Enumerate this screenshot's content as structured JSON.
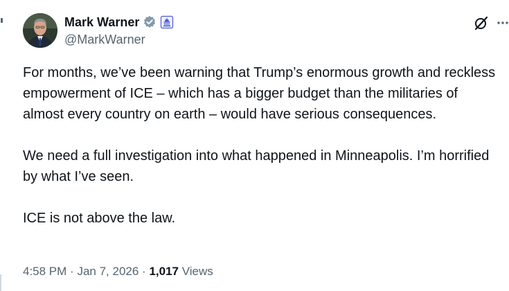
{
  "author": {
    "display_name": "Mark Warner",
    "handle": "@MarkWarner",
    "avatar_icon": "portrait-avatar",
    "verified_icon": "verified-badge-icon",
    "affiliation_icon": "government-badge-icon"
  },
  "actions": {
    "grok_icon": "grok-icon",
    "more_icon": "more-options-icon"
  },
  "tweet": {
    "paragraphs": [
      "For months, we’ve been warning that Trump’s enormous growth and reckless empowerment of ICE – which has a bigger budget than the militaries of almost every country on earth – would have serious consequences.",
      "We need a full investigation into what happened in Minneapolis. I’m horrified by what I’ve seen.",
      "ICE is not above the law."
    ]
  },
  "meta": {
    "time": "4:58 PM",
    "separator": "·",
    "date": "Jan 7, 2026",
    "views_count": "1,017",
    "views_label": "Views"
  },
  "colors": {
    "text_primary": "#0f1419",
    "text_secondary": "#536471",
    "verified_badge": "#829aab",
    "gov_badge": "#4a5bd4"
  }
}
